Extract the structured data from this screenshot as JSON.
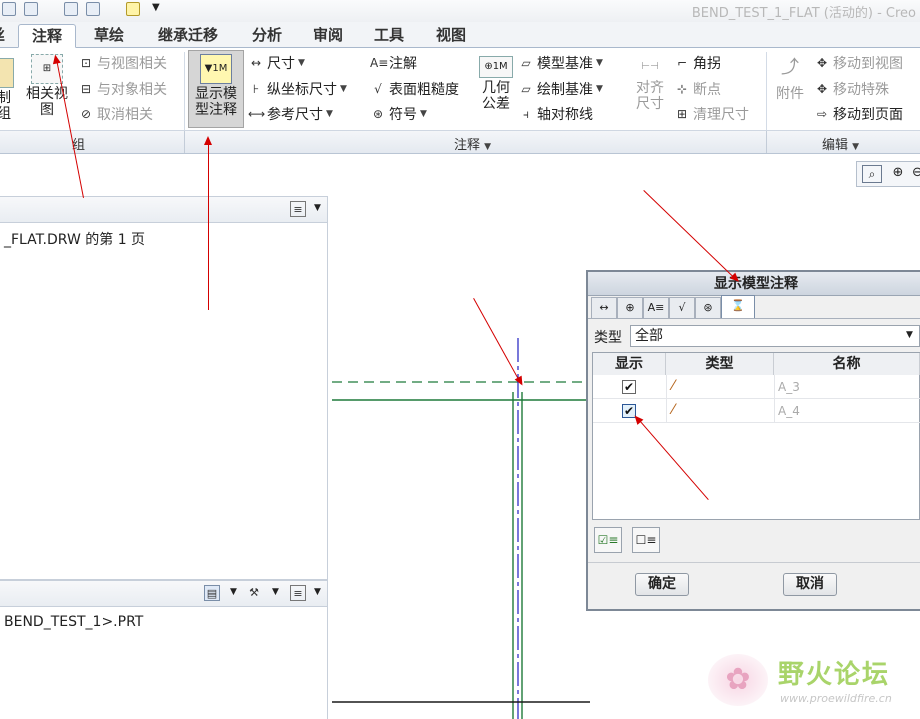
{
  "app_title": "BEND_TEST_1_FLAT (活动的) - Creo",
  "tabs": [
    "注释",
    "草绘",
    "继承迁移",
    "分析",
    "审阅",
    "工具",
    "视图"
  ],
  "ribbon": {
    "group_1": {
      "btn_relation_view": "相关视\n图",
      "btn_with_view": "与视图相关",
      "btn_with_object": "与对象相关",
      "btn_cancel_relation": "取消相关",
      "label": "组"
    },
    "show_model_annotations": "显示模\n型注释",
    "annotation": {
      "label": "注释",
      "dimension": "尺寸",
      "ordinate_dimension": "纵坐标尺寸",
      "reference_dimension": "参考尺寸",
      "note": "注解",
      "surface_finish": "表面粗糙度",
      "symbol": "符号",
      "geometric_tolerance": "几何\n公差",
      "model_datum": "模型基准",
      "draft_datum": "绘制基准",
      "axis_symmetry": "轴对称线",
      "align_dimension": "对齐\n尺寸",
      "corner": "角拐",
      "breakpoint": "断点",
      "clean_dimension": "清理尺寸"
    },
    "edit": {
      "label": "编辑",
      "attach": "附件",
      "move_to_view": "移动到视图",
      "move_special": "移动特殊",
      "move_to_page": "移动到页面"
    }
  },
  "tree_panel": {
    "top_item": "_FLAT.DRW 的第 1 页"
  },
  "model_panel": {
    "item": "BEND_TEST_1>.PRT"
  },
  "dialog": {
    "title": "显示模型注释",
    "type_label": "类型",
    "type_value": "全部",
    "columns": [
      "显示",
      "类型",
      "名称"
    ],
    "rows": [
      {
        "checked": "✔",
        "name": "A_3"
      },
      {
        "checked": "✔",
        "name": "A_4"
      }
    ],
    "ok": "确定",
    "cancel": "取消"
  },
  "watermark": {
    "brand": "野火论坛",
    "url": "www.proewildfire.cn"
  },
  "colors": {
    "accent_blue": "#2b5797",
    "arrow_red": "#d40000",
    "drawing_green": "#1f7a3a"
  }
}
